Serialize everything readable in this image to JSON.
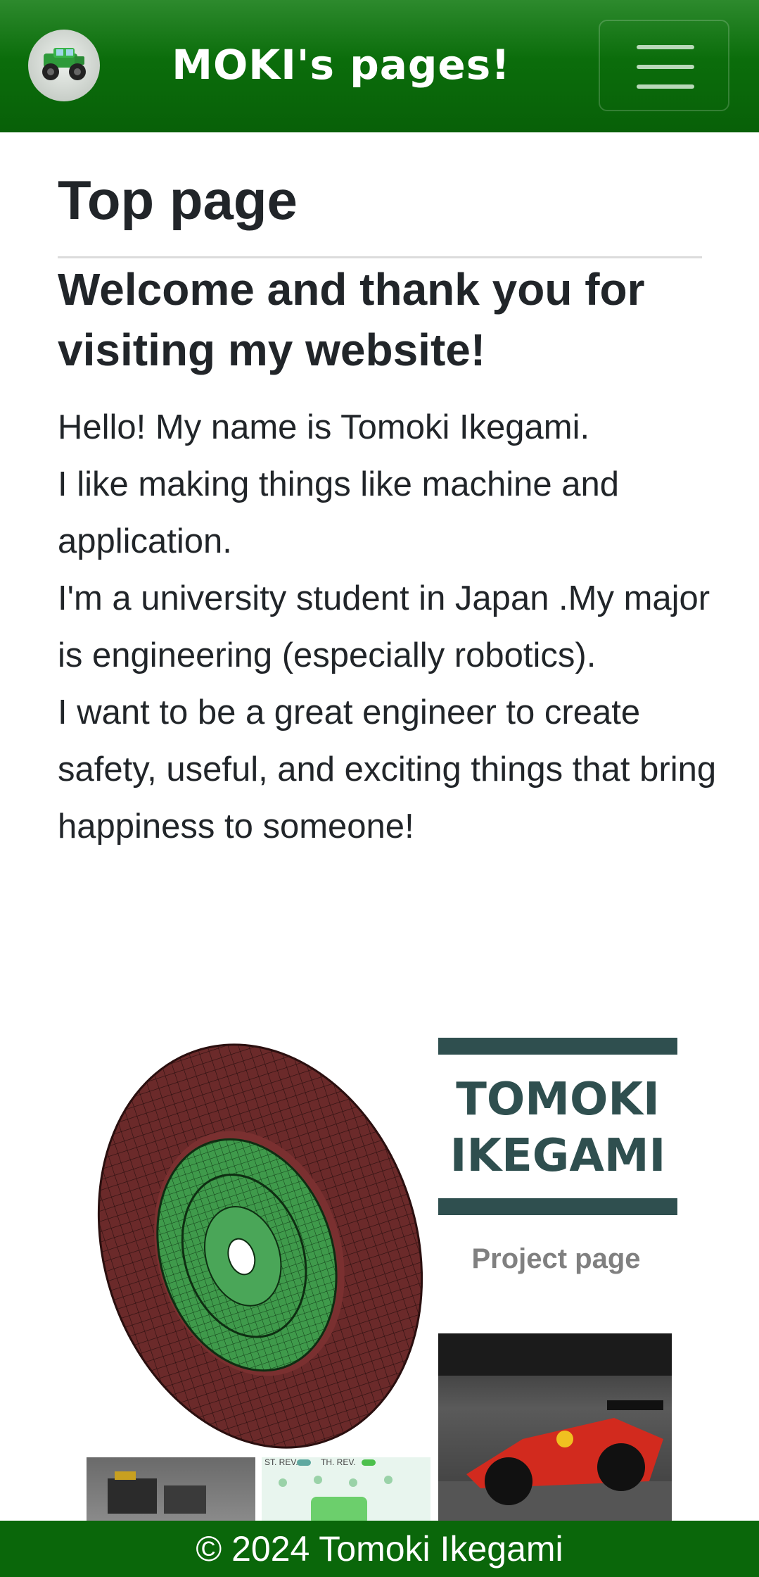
{
  "navbar": {
    "brand_logo_icon": "rc-jeep-icon",
    "title": "MOKI's pages!",
    "toggle_icon": "hamburger-menu-icon"
  },
  "main": {
    "page_title": "Top page",
    "welcome_heading": "Welcome and thank you for visiting my website!",
    "intro_lines": [
      "Hello! My name is Tomoki Ikegami.",
      "I like making things like machine and application.",
      "I'm a university student in Japan .My major is engineering (especially robotics).",
      "I want to be a great engineer to create safety, useful, and exciting things that bring happiness to someone!"
    ]
  },
  "collage": {
    "name_line1": "TOMOKI",
    "name_line2": "IKEGAMI",
    "project_label": "Project page",
    "app_toggle_1": "ST. REV.",
    "app_toggle_2": "TH. REV."
  },
  "footer": {
    "copyright": "© 2024 Tomoki Ikegami"
  },
  "colors": {
    "brand_green": "#0b6d0b",
    "name_card": "#2f4f4f",
    "tire": "#6b2a2a",
    "wheel": "#3f9a4b"
  }
}
